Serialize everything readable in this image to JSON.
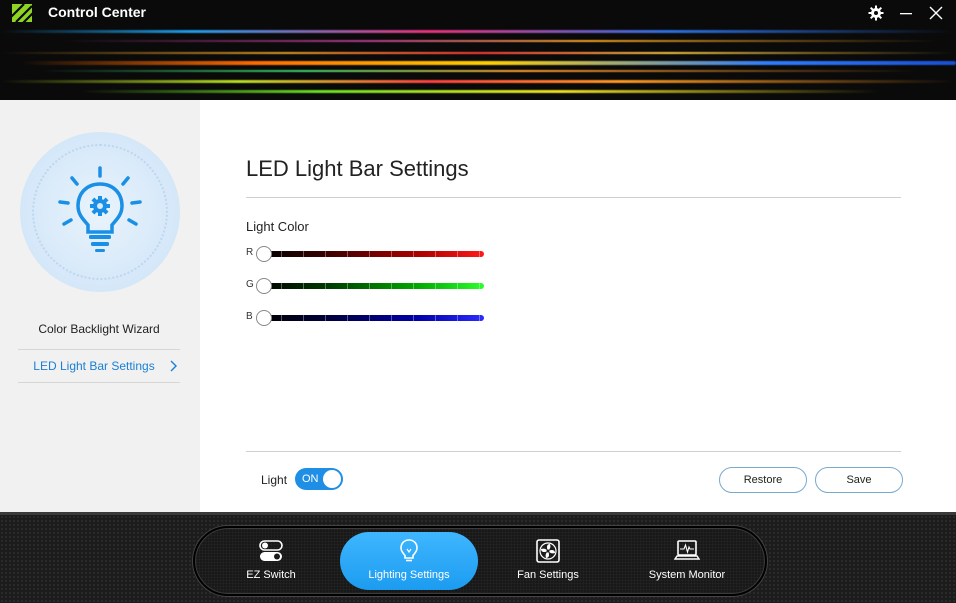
{
  "app": {
    "title": "Control Center"
  },
  "sidebar": {
    "items": [
      {
        "label": "Color Backlight Wizard"
      },
      {
        "label": "LED Light Bar Settings"
      }
    ]
  },
  "main": {
    "title": "LED Light Bar Settings",
    "section_label": "Light Color",
    "sliders": [
      {
        "channel": "R",
        "value": 0
      },
      {
        "channel": "G",
        "value": 0
      },
      {
        "channel": "B",
        "value": 0
      }
    ],
    "light_label": "Light",
    "light_toggle": "ON",
    "restore_label": "Restore",
    "save_label": "Save"
  },
  "dock": {
    "items": [
      {
        "label": "EZ Switch",
        "icon": "toggle-switches-icon"
      },
      {
        "label": "Lighting Settings",
        "icon": "lightbulb-icon"
      },
      {
        "label": "Fan Settings",
        "icon": "fan-icon"
      },
      {
        "label": "System Monitor",
        "icon": "laptop-monitor-icon"
      }
    ],
    "active": "Lighting Settings"
  },
  "colors": {
    "accent": "#1f8fe6",
    "active_link": "#1a7fd6",
    "dock_active": "#2aa8f8"
  }
}
